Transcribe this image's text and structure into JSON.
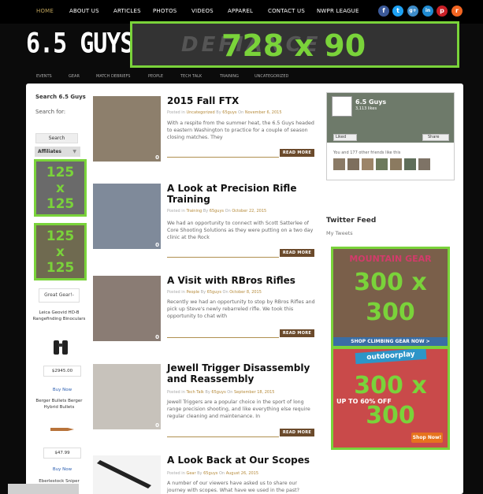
{
  "top_nav": [
    "HOME",
    "ABOUT US",
    "ARTICLES",
    "PHOTOS",
    "VIDEOS",
    "APPAREL",
    "CONTACT US",
    "NWPR LEAGUE"
  ],
  "social_icons": [
    {
      "name": "facebook-icon",
      "glyph": "f",
      "color": "#3b5998"
    },
    {
      "name": "twitter-icon",
      "glyph": "t",
      "color": "#1da1f2"
    },
    {
      "name": "google-plus-icon",
      "glyph": "g+",
      "color": "#3d8cc9"
    },
    {
      "name": "linkedin-icon",
      "glyph": "in",
      "color": "#1f8ad0"
    },
    {
      "name": "pinterest-icon",
      "glyph": "p",
      "color": "#cb2027"
    },
    {
      "name": "rss-icon",
      "glyph": "r",
      "color": "#f26522"
    }
  ],
  "logo": "6.5 GUYS",
  "top_banner": {
    "size_text": "728 x 90",
    "ghost_text": "DEFIANCE"
  },
  "category_nav": [
    "EVENTS",
    "GEAR",
    "MATCH DEBRIEFS",
    "PEOPLE",
    "TECH TALK",
    "TRAINING",
    "UNCATEGORIZED"
  ],
  "left_sidebar": {
    "search_title": "Search 6.5 Guys",
    "search_label": "Search for:",
    "search_button": "Search",
    "affiliates_label": "Affiliates",
    "ad_125_text": [
      "125",
      "x",
      "125"
    ],
    "great_gear_button": "Great Gear!-",
    "product_1": "Leica Geovid HD-B Rangefinding Binoculars",
    "price_1": "$2945.00",
    "buy_now": "Buy Now",
    "product_2": "Berger Bullets Berger Hybrid Bullets",
    "price_2": "$47.99",
    "product_3": "Eberlestock Sniper"
  },
  "posts": [
    {
      "title": "2015 Fall FTX",
      "meta_prefix": "Posted in",
      "category": "Uncategorized",
      "by": "By",
      "author": "65guys",
      "on": "On",
      "date": "November 6, 2015",
      "excerpt": "With a respite from the summer heat, the 6.5 Guys headed to eastern Washington to practice for a couple of season closing matches. They",
      "comments": "0",
      "read_more": "READ MORE"
    },
    {
      "title": "A Look at Precision Rifle Training",
      "meta_prefix": "Posted in",
      "category": "Training",
      "by": "By",
      "author": "65guys",
      "on": "On",
      "date": "October 22, 2015",
      "excerpt": "We had an opportunity to connect with Scott Satterlee of Core Shooting Solutions as they were putting on a two day clinic at the Rock",
      "comments": "0",
      "read_more": "READ MORE"
    },
    {
      "title": "A Visit with RBros Rifles",
      "meta_prefix": "Posted in",
      "category": "People",
      "by": "By",
      "author": "65guys",
      "on": "On",
      "date": "October 8, 2015",
      "excerpt": "Recently we had an opportunity to stop by RBros Rifles and pick up Steve's newly rebarreled rifle. We took this opportunity to chat with",
      "comments": "0",
      "read_more": "READ MORE"
    },
    {
      "title": "Jewell Trigger Disassembly and Reassembly",
      "meta_prefix": "Posted in",
      "category": "Tech Talk",
      "by": "By",
      "author": "65guys",
      "on": "On",
      "date": "September 18, 2015",
      "excerpt": "Jewell Triggers are a popular choice in the sport of long range precision shooting, and like everything else require regular cleaning and maintenance. In",
      "comments": "0",
      "read_more": "READ MORE"
    },
    {
      "title": "A Look Back at Our Scopes",
      "meta_prefix": "Posted in",
      "category": "Gear",
      "by": "By",
      "author": "65guys",
      "on": "On",
      "date": "August 26, 2015",
      "excerpt": "A number of our viewers have asked us to share our journey with scopes. What have we used in the past?",
      "comments": "",
      "read_more": ""
    }
  ],
  "facebook": {
    "page_name": "6.5 Guys",
    "likes": "3,113 likes",
    "liked_button": "Liked",
    "share_button": "Share",
    "friends_text": "You and 177 other friends like this"
  },
  "twitter": {
    "title": "Twitter Feed",
    "subtitle": "My Tweets"
  },
  "ad_300_1": {
    "size_lines": [
      "300 x",
      "300"
    ],
    "text": "MOUNTAIN GEAR",
    "footer": "SHOP CLIMBING GEAR NOW >"
  },
  "ad_300_2": {
    "size_lines": [
      "300 x",
      "300"
    ],
    "brand": "outdoorplay",
    "promo": "UP TO 60% OFF",
    "button": "Shop Now!"
  },
  "colors": {
    "accent": "#7ad33a",
    "brown": "#6b4a2b",
    "link": "#b58a3a"
  }
}
